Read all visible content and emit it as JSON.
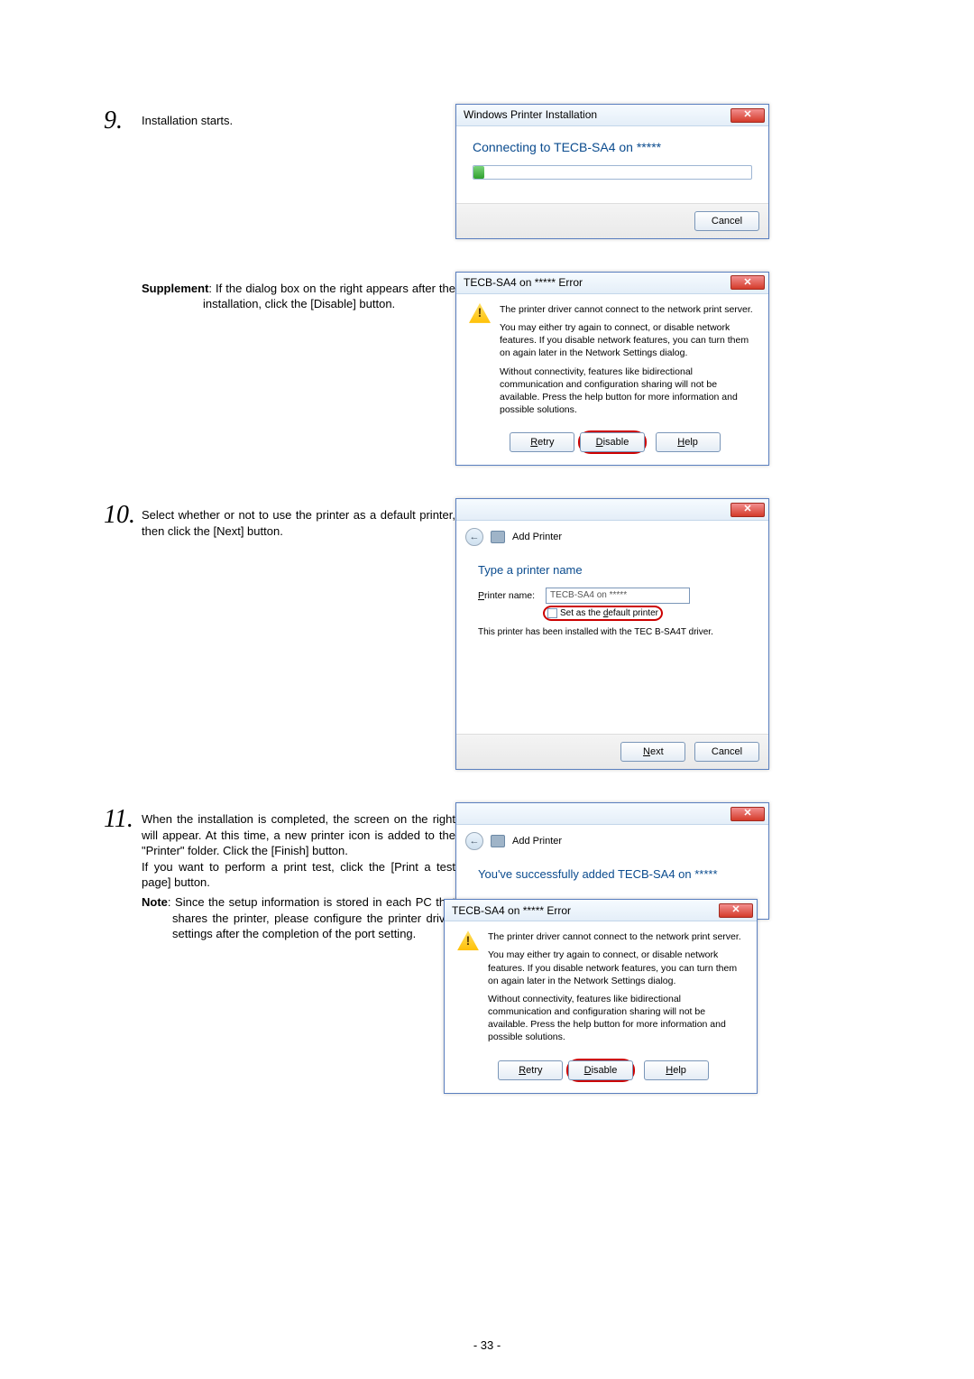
{
  "steps": {
    "s9": {
      "num": "9.",
      "text": "Installation starts."
    },
    "supp": {
      "label": "Supplement",
      "text": ": If the dialog box on the right appears after the installation, click the [Disable] button."
    },
    "s10": {
      "num": "10.",
      "text": "Select whether or not to use the printer as a default printer, then click the [Next] button."
    },
    "s11": {
      "num": "11.",
      "p1": "When the installation is completed, the screen on the right will appear.  At this time, a new printer icon is added to the \"Printer\" folder.  Click the [Finish] button.",
      "p2": "If you want to perform a print test, click the [Print a test page] button.",
      "note_label": "Note",
      "note_text": ": Since the setup information is stored in each PC that shares the printer, please configure the printer driver settings after the completion of the port setting."
    }
  },
  "dlg_install": {
    "title": "Windows Printer Installation",
    "heading": "Connecting to TECB-SA4 on *****",
    "cancel": "Cancel"
  },
  "dlg_error": {
    "title": "TECB-SA4 on ***** Error",
    "l1": "The printer driver cannot connect to the network print server.",
    "l2": "You may either try again to connect, or disable network features.  If you disable network features, you can turn them on again later in the Network Settings dialog.",
    "l3": "Without connectivity, features like bidirectional communication and configuration sharing will not be available.  Press the help button for more information and possible solutions.",
    "retry": "Retry",
    "disable": "Disable",
    "help": "Help"
  },
  "dlg_wizard_name": {
    "hdr": "Add Printer",
    "heading": "Type a printer name",
    "field_label": "Printer name:",
    "field_value": "TECB-SA4 on *****",
    "check_label": "Set as the default printer",
    "note": "This printer has been installed with the TEC B-SA4T driver.",
    "next": "Next",
    "cancel": "Cancel"
  },
  "dlg_wizard_done": {
    "hdr": "Add Printer",
    "heading": "You've successfully added TECB-SA4 on  *****"
  },
  "page_number": "- 33 -"
}
